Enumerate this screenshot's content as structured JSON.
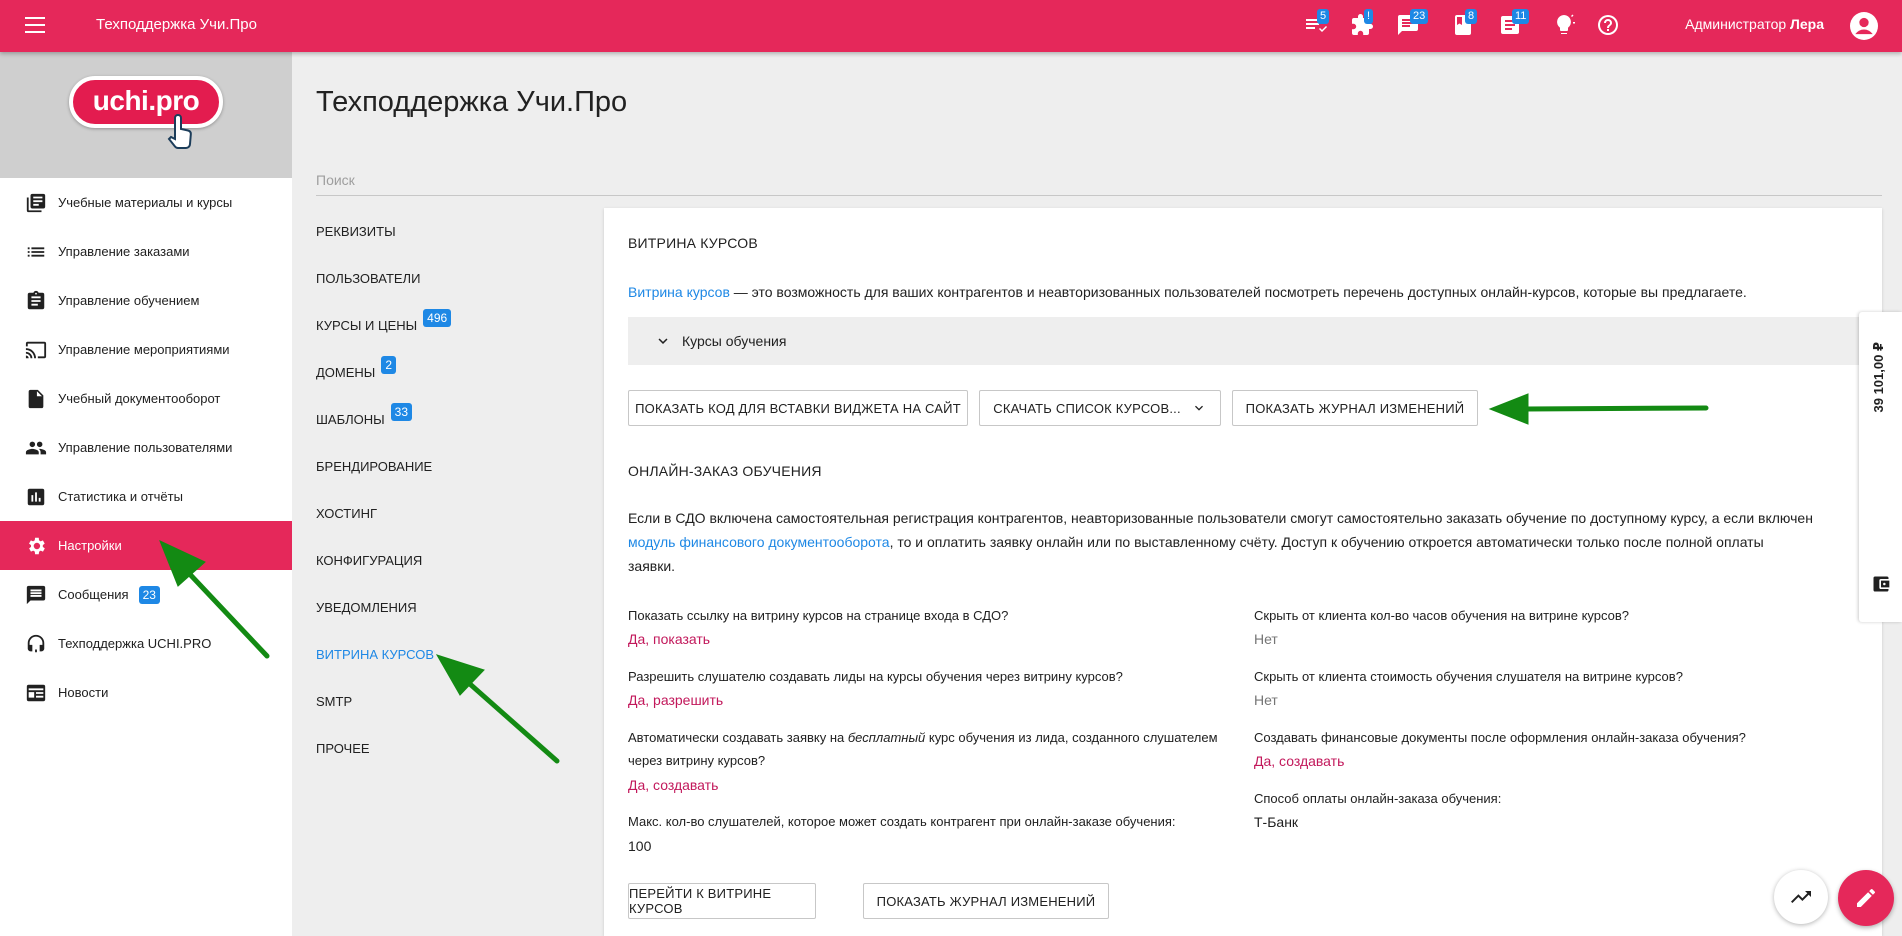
{
  "topbar": {
    "title": "Техподдержка Учи.Про",
    "badges": {
      "tasks": "5",
      "puzzle": "!",
      "chat": "23",
      "book": "8",
      "doc": "11"
    },
    "admin_role": "Администратор",
    "admin_name": "Лера"
  },
  "logo": {
    "text": "uchi.pro"
  },
  "sidebar": {
    "items": [
      {
        "label": "Учебные материалы и курсы",
        "icon": "library-books-icon"
      },
      {
        "label": "Управление заказами",
        "icon": "list-icon"
      },
      {
        "label": "Управление обучением",
        "icon": "assignment-icon"
      },
      {
        "label": "Управление мероприятиями",
        "icon": "cast-icon"
      },
      {
        "label": "Учебный документооборот",
        "icon": "document-icon"
      },
      {
        "label": "Управление пользователями",
        "icon": "people-icon"
      },
      {
        "label": "Статистика и отчёты",
        "icon": "chart-icon"
      },
      {
        "label": "Настройки",
        "icon": "gear-icon",
        "active": true
      },
      {
        "label": "Сообщения",
        "icon": "message-icon",
        "badge": "23"
      },
      {
        "label": "Техподдержка UCHI.PRO",
        "icon": "support-icon"
      },
      {
        "label": "Новости",
        "icon": "news-icon"
      }
    ]
  },
  "page": {
    "title": "Техподдержка Учи.Про",
    "search_placeholder": "Поиск"
  },
  "subnav": {
    "items": [
      {
        "label": "РЕКВИЗИТЫ"
      },
      {
        "label": "ПОЛЬЗОВАТЕЛИ"
      },
      {
        "label": "КУРСЫ И ЦЕНЫ",
        "badge": "496"
      },
      {
        "label": "ДОМЕНЫ",
        "badge": "2"
      },
      {
        "label": "ШАБЛОНЫ",
        "badge": "33"
      },
      {
        "label": "БРЕНДИРОВАНИЕ"
      },
      {
        "label": "ХОСТИНГ"
      },
      {
        "label": "КОНФИГУРАЦИЯ"
      },
      {
        "label": "УВЕДОМЛЕНИЯ"
      },
      {
        "label": "ВИТРИНА КУРСОВ",
        "active": true
      },
      {
        "label": "SMTP"
      },
      {
        "label": "ПРОЧЕЕ"
      }
    ]
  },
  "showcase": {
    "heading": "ВИТРИНА КУРСОВ",
    "desc_link": "Витрина курсов",
    "desc_text": " — это возможность для ваших контрагентов и неавторизованных пользователей посмотреть перечень доступных онлайн-курсов, которые вы предлагаете.",
    "accordion_label": "Курсы обучения",
    "btn_widget": "ПОКАЗАТЬ КОД ДЛЯ ВСТАВКИ ВИДЖЕТА НА САЙТ",
    "btn_download": "СКАЧАТЬ СПИСОК КУРСОВ...",
    "btn_log": "ПОКАЗАТЬ ЖУРНАЛ ИЗМЕНЕНИЙ"
  },
  "online": {
    "heading": "ОНЛАЙН-ЗАКАЗ ОБУЧЕНИЯ",
    "p1": "Если в СДО включена самостоятельная регистрация контрагентов, неавторизованные пользователи смогут самостоятельно заказать обучение по доступному курсу, а если включен",
    "p2_link": "модуль финансового документооборота",
    "p2_text": ", то и оплатить заявку онлайн или по выставленному счёту. Доступ к обучению откроется автоматически только после полной оплаты",
    "p3": "заявки.",
    "left": [
      {
        "q": "Показать ссылку на витрину курсов на странице входа в СДО?",
        "a": "Да, показать"
      },
      {
        "q": "Разрешить слушателю создавать лиды на курсы обучения через витрину курсов?",
        "a": "Да, разрешить"
      },
      {
        "q_pre": "Автоматически создавать заявку на ",
        "q_em": "бесплатный",
        "q_post": " курс обучения из лида, созданного слушателем",
        "q_line2": "через витрину курсов?",
        "a": "Да, создавать"
      },
      {
        "q": "Макс. кол-во слушателей, которое может создать контрагент при онлайн-заказе обучения:",
        "a": "100"
      }
    ],
    "right": [
      {
        "q": "Скрыть от клиента кол-во часов обучения на витрине курсов?",
        "a": "Нет"
      },
      {
        "q": "Скрыть от клиента стоимость обучения слушателя на витрине курсов?",
        "a": "Нет"
      },
      {
        "q": "Создавать финансовые документы после оформления онлайн-заказа обучения?",
        "a": "Да, создавать"
      },
      {
        "q": "Способ оплаты онлайн-заказа обучения:",
        "a": "Т-Банк"
      }
    ],
    "btn_goto": "ПЕРЕЙТИ К ВИТРИНЕ КУРСОВ",
    "btn_log": "ПОКАЗАТЬ ЖУРНАЛ ИЗМЕНЕНИЙ"
  },
  "balance": {
    "amount": "39 101,00 ₽"
  },
  "colors": {
    "brand": "#e5285a",
    "accent": "#1e88e5",
    "answer": "#c2185b",
    "arrow": "#138a13"
  }
}
